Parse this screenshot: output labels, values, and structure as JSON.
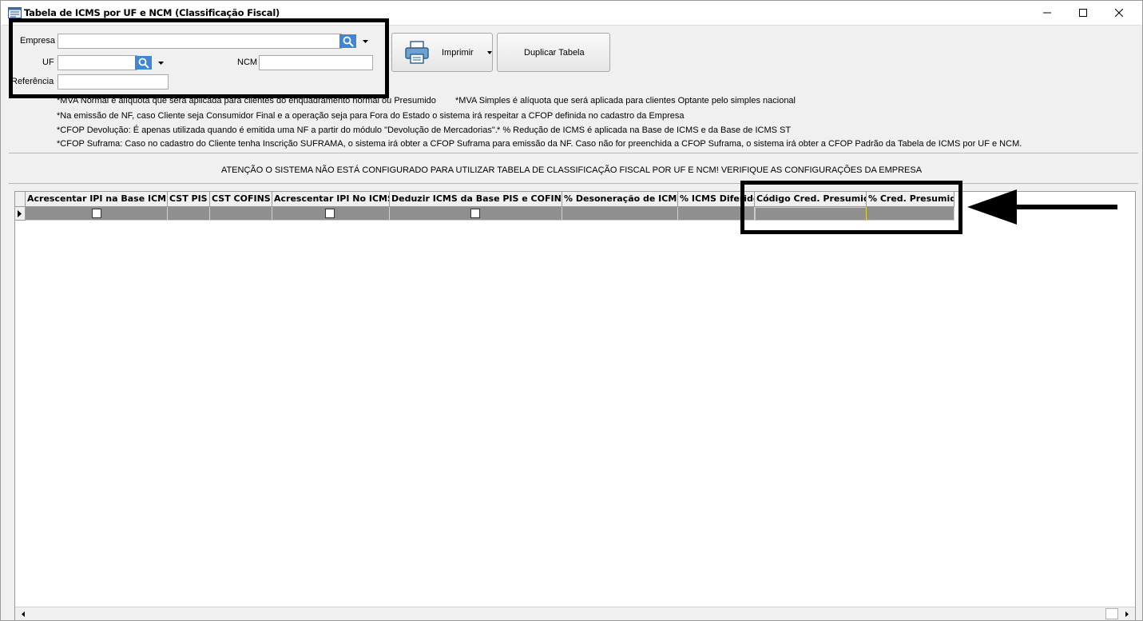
{
  "window": {
    "title": "Tabela de ICMS por UF e NCM (Classificação Fiscal)",
    "controls": [
      "minimize-icon",
      "maximize-icon",
      "close-icon"
    ]
  },
  "filters": {
    "empresa_label": "Empresa",
    "empresa_value": "",
    "uf_label": "UF",
    "uf_value": "",
    "ncm_label": "NCM",
    "ncm_value": "",
    "referencia_label": "Referência",
    "referencia_value": ""
  },
  "toolbar": {
    "imprimir_label": "Imprimir",
    "duplicar_label": "Duplicar Tabela"
  },
  "notes": {
    "mva_normal": "*MVA Normal é alíquota que será aplicada para clientes do enquadramento normal ou Presumido",
    "mva_simples": "*MVA Simples é alíquota que será aplicada para clientes Optante pelo simples nacional",
    "emissao_nf": "*Na emissão de NF, caso Cliente seja Consumidor Final e a operação seja para Fora do Estado o sistema irá respeitar a CFOP definida no cadastro da Empresa",
    "cfop_devolucao": "*CFOP Devolução: É apenas utilizada quando é emitida uma NF a partir do módulo \"Devolução de Mercadorias\".",
    "reducao_icms": "* % Redução de ICMS é aplicada na Base de ICMS e da Base de ICMS ST",
    "cfop_suframa": "*CFOP Suframa: Caso no cadastro do Cliente tenha Inscrição SUFRAMA, o sistema irá obter a CFOP Suframa para emissão da NF. Caso não for preenchida a CFOP Suframa, o sistema irá obter a CFOP Padrão da Tabela de ICMS por UF e NCM."
  },
  "warning": "ATENÇÃO O SISTEMA NÃO ESTÁ CONFIGURADO PARA UTILIZAR TABELA DE CLASSIFICAÇÃO FISCAL POR UF E NCM! VERIFIQUE AS CONFIGURAÇÕES DA EMPRESA",
  "grid": {
    "columns": [
      "Acrescentar IPI na Base ICMS",
      "CST PIS",
      "CST COFINS",
      "Acrescentar IPI No ICMS",
      "Deduzir ICMS da Base PIS e COFINS",
      "% Desoneração de ICMS",
      "% ICMS Diferido",
      "Código Cred. Presumido",
      "% Cred. Presumido"
    ],
    "rows": [
      {
        "acrescentar_ipi_base_icms": false,
        "cst_pis": "",
        "cst_cofins": "",
        "acrescentar_ipi_no_icms": false,
        "deduzir_icms_base_pis_cofins": false,
        "desoneracao_icms": "",
        "icms_diferido": "",
        "codigo_cred_presumido": "",
        "cred_presumido": ""
      }
    ]
  },
  "colors": {
    "lookup_button": "#3f86d6",
    "row_background": "#8f8f8f",
    "focus_cell_border": "#e0d23c",
    "annotation": "#000000"
  }
}
